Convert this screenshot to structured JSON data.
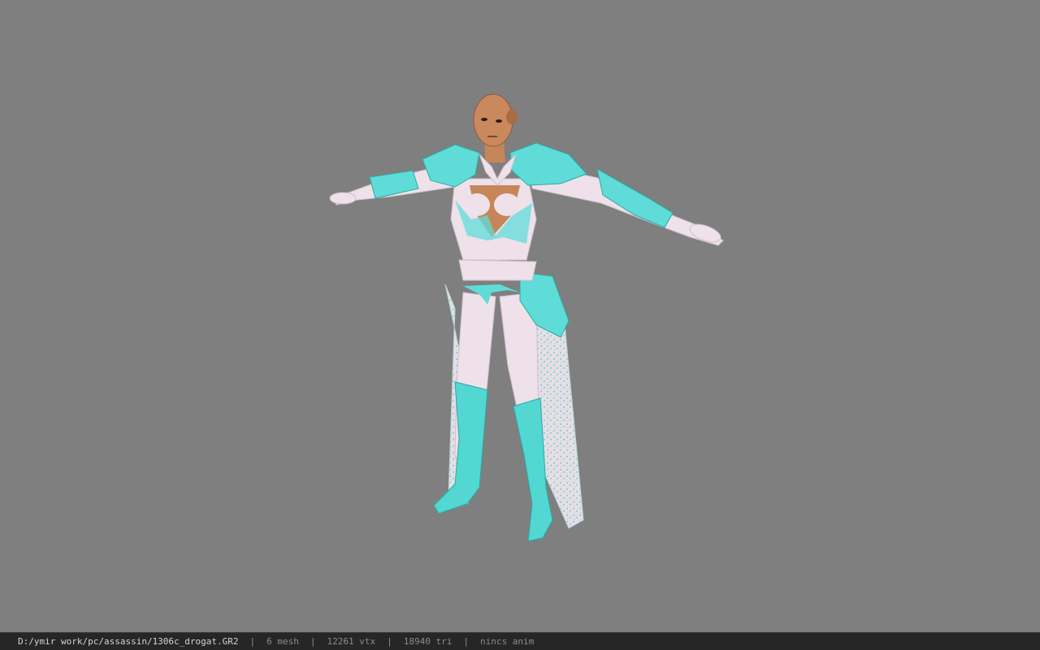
{
  "viewer": {
    "background_color": "#7f7f7f",
    "model": {
      "description_icon": "character-model-icon",
      "armor_color": "#4fd6d2",
      "suit_color": "#eee1ea"
    }
  },
  "statusbar": {
    "file_path": "D:/ymir work/pc/assassin/1306c_drogat.GR2",
    "separator": "|",
    "mesh": "6 mesh",
    "vtx": "12261 vtx",
    "tri": "18940 tri",
    "anim": "nincs anim"
  }
}
